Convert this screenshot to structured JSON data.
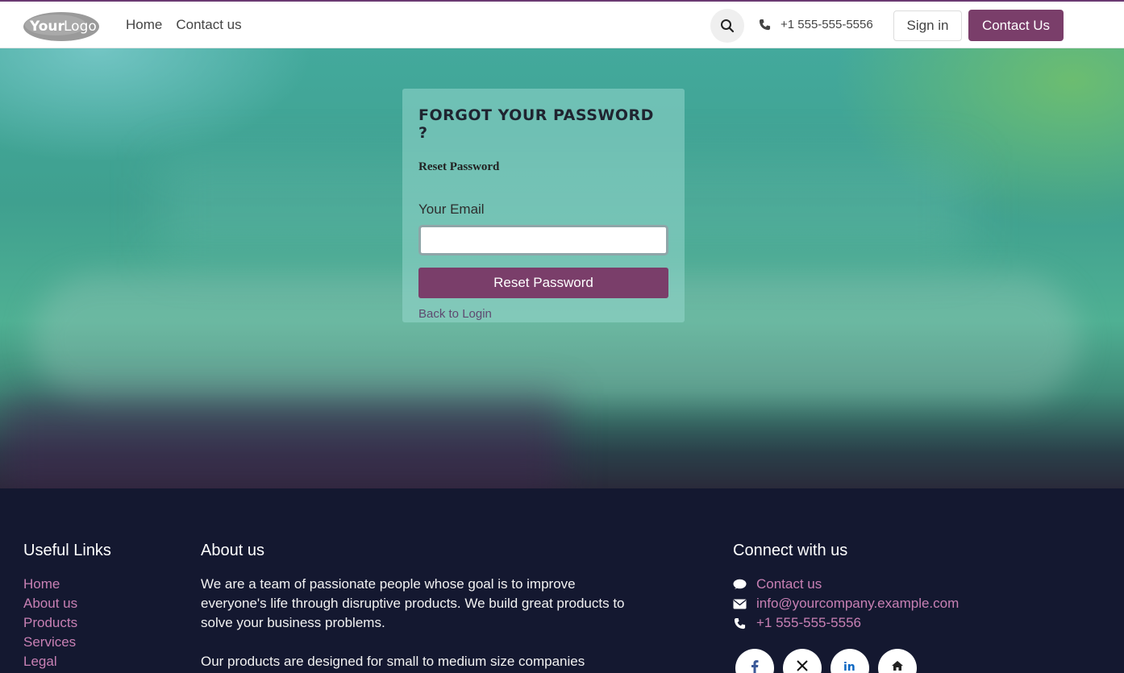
{
  "header": {
    "logo_text": "YourLogo",
    "nav": [
      {
        "label": "Home"
      },
      {
        "label": "Contact us"
      }
    ],
    "phone": "+1 555-555-5556",
    "signin_label": "Sign in",
    "contact_label": "Contact Us"
  },
  "form": {
    "title": "FORGOT YOUR PASSWORD ?",
    "subtitle": "Reset Password",
    "email_label": "Your Email",
    "email_value": "",
    "submit_label": "Reset Password",
    "back_label": "Back to Login"
  },
  "footer": {
    "useful_links_title": "Useful Links",
    "useful_links": [
      "Home",
      "About us",
      "Products",
      "Services",
      "Legal"
    ],
    "about_title": "About us",
    "about_p1": "We are a team of passionate people whose goal is to improve everyone's life through disruptive products. We build great products to solve your business problems.",
    "about_p2": "Our products are designed for small to medium size companies",
    "connect_title": "Connect with us",
    "connect_items": [
      {
        "icon": "comment-icon",
        "label": "Contact us"
      },
      {
        "icon": "envelope-icon",
        "label": "info@yourcompany.example.com"
      },
      {
        "icon": "phone-icon",
        "label": "+1 555-555-5556"
      }
    ],
    "socials": [
      "facebook-icon",
      "x-icon",
      "linkedin-icon",
      "home-icon"
    ]
  },
  "colors": {
    "brand": "#7a3e6a",
    "link": "#c880b4",
    "footer_bg": "#141830"
  }
}
